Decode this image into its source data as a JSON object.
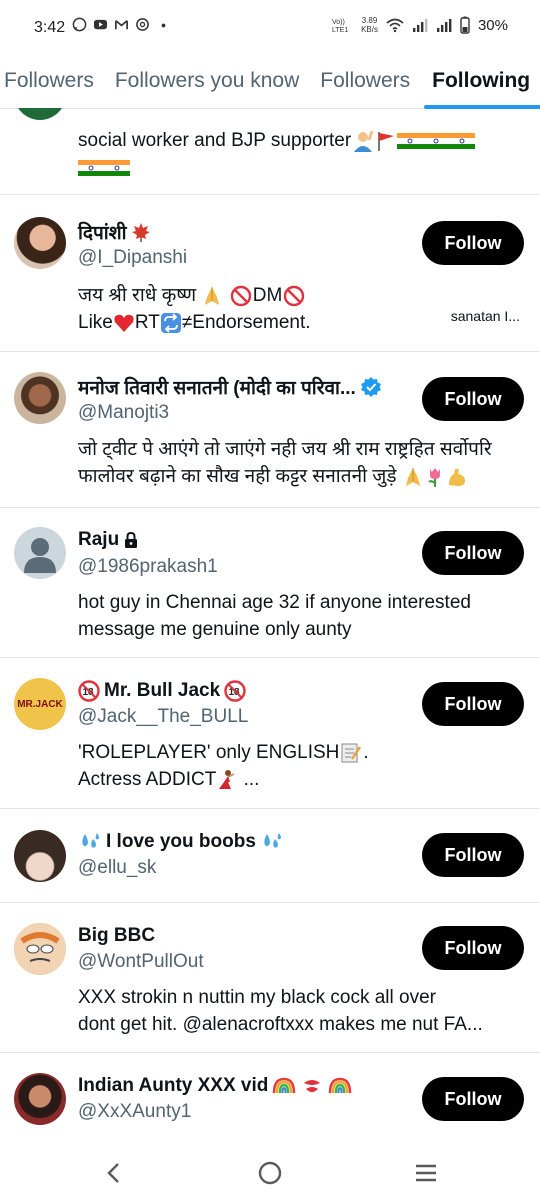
{
  "status_bar": {
    "time": "3:42",
    "network_speed": "3.89",
    "network_unit": "KB/s",
    "volte": "VoLTE1",
    "battery": "30%"
  },
  "tabs": [
    {
      "label": "Followers"
    },
    {
      "label": "Followers you know"
    },
    {
      "label": "Followers"
    },
    {
      "label": "Following",
      "active": true
    }
  ],
  "top_item": {
    "bio_line1": "social worker and BJP supporter",
    "emoji_note": "person-raising-hand, red-flag, india-flag x5"
  },
  "users": [
    {
      "name": "दिपांशी",
      "handle": "@I_Dipanshi",
      "bio_line1": "जय श्री राधे कृष्ण",
      "bio_line2a": "Like",
      "bio_line2b": "RT",
      "bio_line2c": "≠Endorsement.",
      "bio_line1b": "DM",
      "extra": "sanatan I...",
      "follow_label": "Follow"
    },
    {
      "name": "मनोज तिवारी सनातनी (मोदी का परिवा...",
      "handle": "@Manojti3",
      "bio_line1": "जो ट्वीट पे आएंगे तो जाएंगे नही जय श्री राम राष्ट्रहित सर्वोपरि",
      "bio_line2": "फालोवर बढ़ाने का सौख नही कट्टर सनातनी जुड़े",
      "verified": true,
      "follow_label": "Follow"
    },
    {
      "name": "Raju",
      "handle": "@1986prakash1",
      "bio_line1": "hot guy in Chennai age 32 if anyone interested",
      "bio_line2": "message me genuine only aunty",
      "locked": true,
      "follow_label": "Follow"
    },
    {
      "name": "Mr. Bull Jack",
      "handle": "@Jack__The_BULL",
      "bio_line1": "'ROLEPLAYER' only ENGLISH",
      "bio_line2": "Actress ADDICT",
      "bio_line2_suffix": "...",
      "avatar_text": "MR.JACK",
      "follow_label": "Follow"
    },
    {
      "name": "I love you boobs",
      "handle": "@ellu_sk",
      "follow_label": "Follow"
    },
    {
      "name": "Big BBC",
      "handle": "@WontPullOut",
      "bio_line1": "XXX strokin n nuttin my black cock all over",
      "bio_line2": "dont get hit. @alenacroftxxx makes me nut FA...",
      "follow_label": "Follow"
    },
    {
      "name": "Indian Aunty XXX vid",
      "handle": "@XxXAunty1",
      "follow_label": "Follow"
    }
  ],
  "colors": {
    "accent": "#1d9bf0",
    "follow_bg": "#000000",
    "secondary_text": "#536471"
  },
  "nav": {
    "back": "back-icon",
    "home": "home-icon",
    "recents": "recents-icon"
  }
}
